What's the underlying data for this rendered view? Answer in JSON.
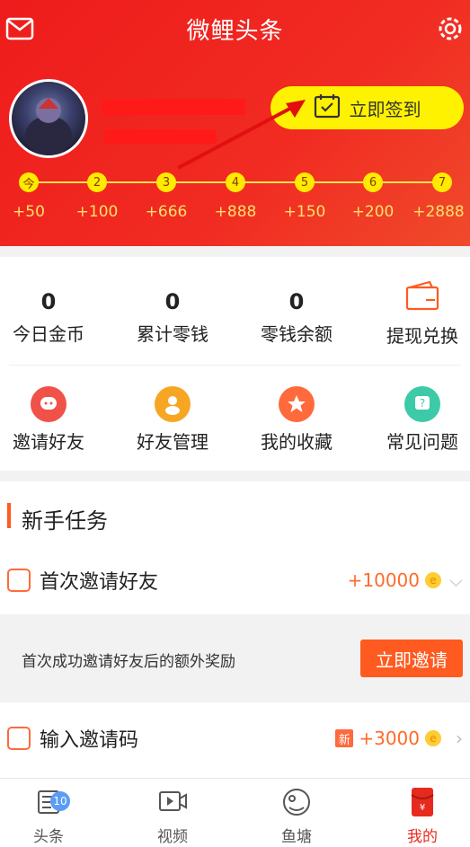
{
  "app": {
    "title": "微鲤头条"
  },
  "header": {
    "signin_label": "立即签到",
    "days": [
      "今",
      "2",
      "3",
      "4",
      "5",
      "6",
      "7"
    ],
    "rewards": [
      "+50",
      "+100",
      "+666",
      "+888",
      "+150",
      "+200",
      "+2888"
    ]
  },
  "stats": [
    {
      "value": "0",
      "label": "今日金币"
    },
    {
      "value": "0",
      "label": "累计零钱"
    },
    {
      "value": "0",
      "label": "零钱余额"
    },
    {
      "label": "提现兑换"
    }
  ],
  "shortcuts": [
    {
      "label": "邀请好友",
      "color": "#f0524a"
    },
    {
      "label": "好友管理",
      "color": "#f6a623"
    },
    {
      "label": "我的收藏",
      "color": "#ff6a3d"
    },
    {
      "label": "常见问题",
      "color": "#3ccaa8"
    }
  ],
  "tasks": {
    "section_title": "新手任务",
    "items": [
      {
        "name": "首次邀请好友",
        "reward": "+10000"
      },
      {
        "name": "输入邀请码",
        "reward": "+3000",
        "badge": "新"
      }
    ],
    "detail_text": "首次成功邀请好友后的额外奖励",
    "detail_button": "立即邀请"
  },
  "bottom_nav": [
    {
      "label": "头条",
      "badge": "10"
    },
    {
      "label": "视频"
    },
    {
      "label": "鱼塘"
    },
    {
      "label": "我的",
      "active": true
    }
  ],
  "colors": {
    "brand_red": "#ee1c1c",
    "signin_yellow": "#fff200",
    "accent_orange": "#ff5a1f"
  }
}
